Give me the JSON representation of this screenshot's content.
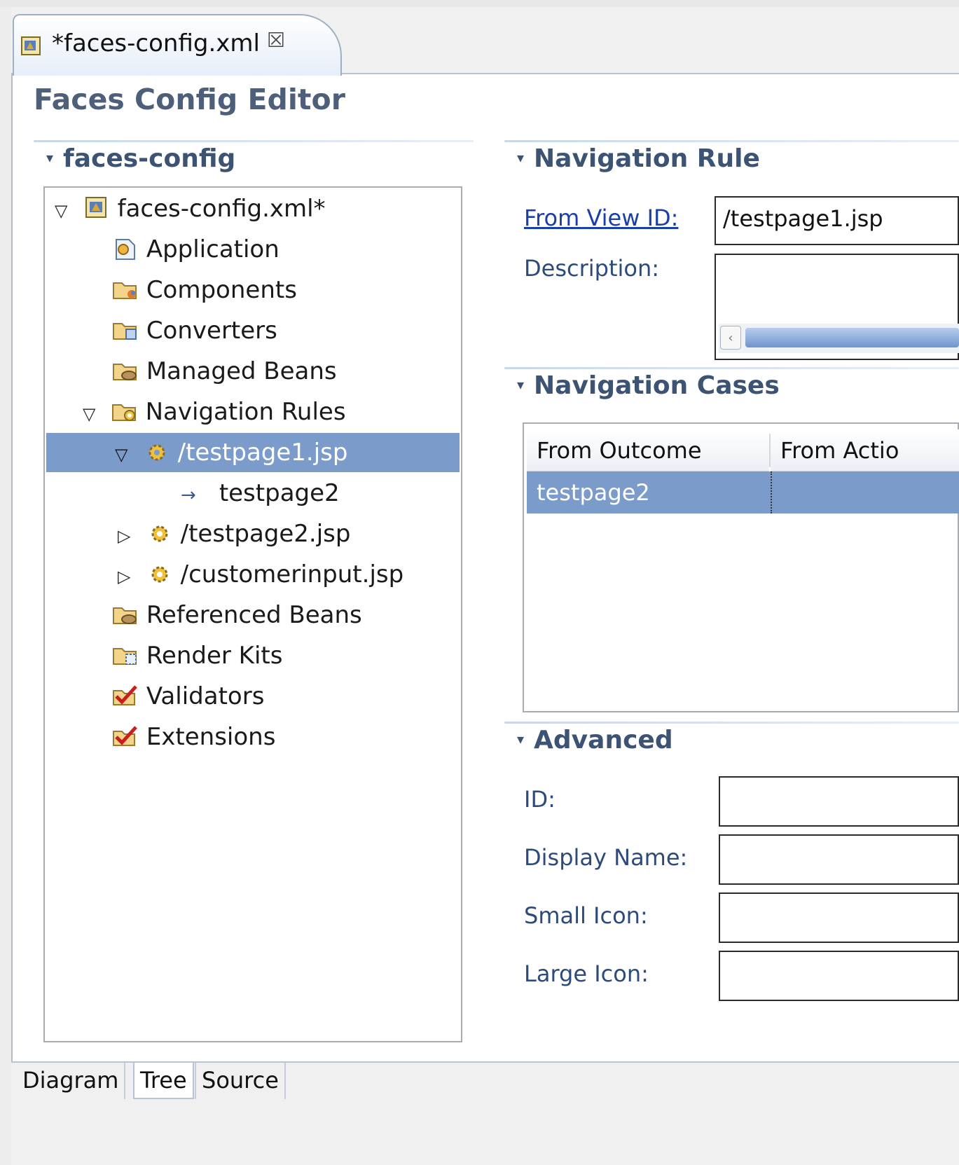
{
  "editor_tab": {
    "title": "*faces-config.xml",
    "close_icon": "⮽"
  },
  "page_title": "Faces Config Editor",
  "tree_section": {
    "title": "faces-config",
    "items": [
      {
        "label": "faces-config.xml*",
        "icon": "faces-config-file-icon",
        "expander": "▽"
      },
      {
        "label": "Application",
        "icon": "application-icon"
      },
      {
        "label": "Components",
        "icon": "components-folder-icon"
      },
      {
        "label": "Converters",
        "icon": "converters-folder-icon"
      },
      {
        "label": "Managed Beans",
        "icon": "beans-folder-icon"
      },
      {
        "label": "Navigation Rules",
        "icon": "navigation-folder-icon",
        "expander": "▽"
      },
      {
        "label": "/testpage1.jsp",
        "icon": "gear-icon",
        "expander": "▽",
        "selected": true
      },
      {
        "label": "testpage2",
        "icon": "arrow-right-icon"
      },
      {
        "label": "/testpage2.jsp",
        "icon": "gear-icon",
        "expander": "▷"
      },
      {
        "label": "/customerinput.jsp",
        "icon": "gear-icon",
        "expander": "▷"
      },
      {
        "label": "Referenced Beans",
        "icon": "beans-folder-icon"
      },
      {
        "label": "Render Kits",
        "icon": "render-kits-folder-icon"
      },
      {
        "label": "Validators",
        "icon": "checkmark-icon"
      },
      {
        "label": "Extensions",
        "icon": "checkmark-icon"
      }
    ]
  },
  "navigation_rule": {
    "title": "Navigation Rule",
    "from_view_id_label": "From View ID:",
    "from_view_id_value": "/testpage1.jsp",
    "description_label": "Description:",
    "description_value": "",
    "scroll_left_glyph": "‹"
  },
  "navigation_cases": {
    "title": "Navigation Cases",
    "columns": [
      "From Outcome",
      "From Actio"
    ],
    "rows": [
      {
        "from_outcome": "testpage2",
        "from_action": ""
      }
    ]
  },
  "advanced": {
    "title": "Advanced",
    "fields": [
      {
        "label": "ID:",
        "value": ""
      },
      {
        "label": "Display Name:",
        "value": ""
      },
      {
        "label": "Small Icon:",
        "value": ""
      },
      {
        "label": "Large Icon:",
        "value": ""
      }
    ]
  },
  "bottom_tabs": [
    "Diagram",
    "Tree",
    "Source"
  ],
  "collapse_glyph": "▾",
  "colors": {
    "section_title": "#3d5373",
    "selection": "#7b9ccb",
    "label": "#2d4a7d"
  }
}
